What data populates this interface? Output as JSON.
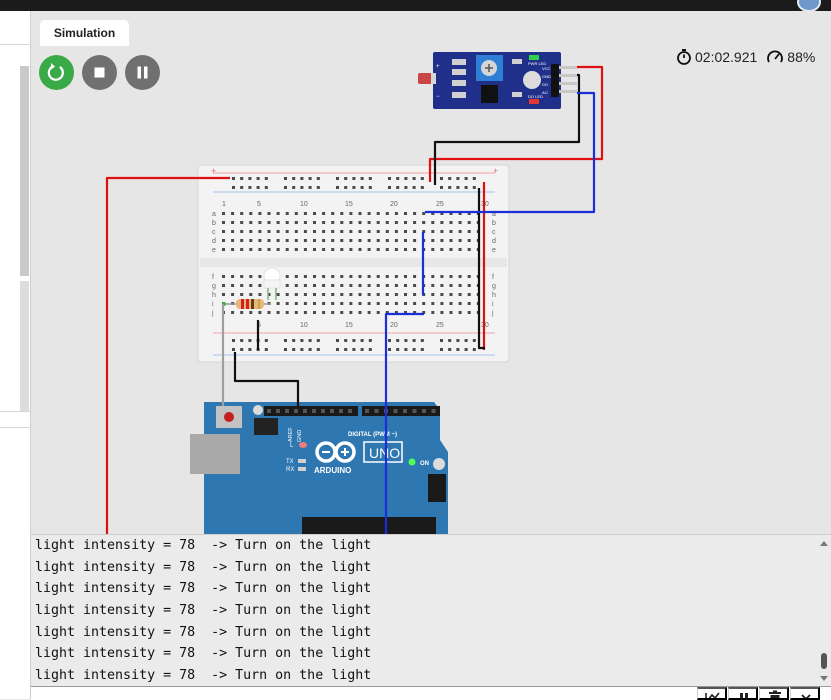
{
  "simulation": {
    "tab_label": "Simulation",
    "elapsed_time": "02:02.921",
    "performance": "88%",
    "controls": [
      {
        "name": "restart",
        "icon": "restart-icon"
      },
      {
        "name": "stop",
        "icon": "stop-icon"
      },
      {
        "name": "pause",
        "icon": "pause-icon"
      }
    ],
    "colors": {
      "restart": "#3aa947",
      "controls": "#707070",
      "board": "#2f77b0",
      "wire_red": "#e01010",
      "wire_blue": "#1a2fd8",
      "wire_black": "#111111"
    }
  },
  "sensor": {
    "vcc": "VCC",
    "gnd": "GND",
    "do": "DO",
    "ao": "AO",
    "pwr_led": "PWR LED",
    "do_led": "DO LED"
  },
  "breadboard": {
    "column_numbers": [
      "1",
      "5",
      "10",
      "15",
      "20",
      "25",
      "30"
    ],
    "rows_top": [
      "a",
      "b",
      "c",
      "d",
      "e"
    ],
    "rows_bottom": [
      "f",
      "g",
      "h",
      "i",
      "j"
    ]
  },
  "arduino": {
    "brand": "ARDUINO",
    "model": "UNO",
    "digital_label": "DIGITAL (PWM ~)",
    "on_label": "ON",
    "tx_label": "TX",
    "rx_label": "RX",
    "aref": "AREF",
    "gnd": "GND",
    "led_label": "L"
  },
  "serial_monitor": {
    "lines": [
      "light intensity = 78  -> Turn on the light",
      "light intensity = 78  -> Turn on the light",
      "light intensity = 78  -> Turn on the light",
      "light intensity = 78  -> Turn on the light",
      "light intensity = 78  -> Turn on the light",
      "light intensity = 78  -> Turn on the light",
      "light intensity = 78  -> Turn on the light"
    ],
    "input_value": "",
    "buttons": [
      {
        "name": "plotter",
        "icon": "chart-icon"
      },
      {
        "name": "pause",
        "icon": "pause-icon"
      },
      {
        "name": "clear",
        "icon": "trash-icon"
      },
      {
        "name": "collapse",
        "icon": "chevron-down-icon"
      }
    ]
  }
}
